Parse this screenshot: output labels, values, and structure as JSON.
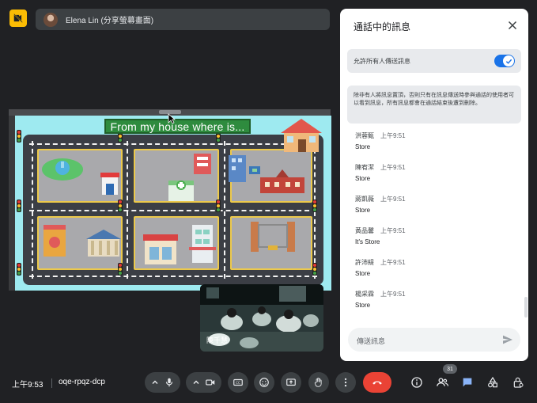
{
  "presenter": {
    "name": "Elena Lin (分享螢幕畫面)"
  },
  "shared_screen": {
    "slide_title": "From my house where is..."
  },
  "self_view": {
    "name": "陳千慧"
  },
  "chat_panel": {
    "title": "通話中的訊息",
    "toggle_label": "允許所有人傳送訊息",
    "notice": "除非有人將訊息置頂，否則只有在訊息傳送時參與通話的使用者可以看到訊息，所有訊息都會在通話結束後遭到刪除。",
    "messages": [
      {
        "sender": "洪蓉甄",
        "time": "上午9:51",
        "text": "Store"
      },
      {
        "sender": "陳宥潔",
        "time": "上午9:51",
        "text": "Store"
      },
      {
        "sender": "蔣凱薇",
        "time": "上午9:51",
        "text": "Store"
      },
      {
        "sender": "黃品馨",
        "time": "上午9:51",
        "text": "It's Store"
      },
      {
        "sender": "許沛緹",
        "time": "上午9:51",
        "text": "Store"
      },
      {
        "sender": "楊采霖",
        "time": "上午9:51",
        "text": "Store"
      }
    ],
    "send_placeholder": "傳送訊息"
  },
  "bottom_bar": {
    "clock": "上午9:53",
    "meeting_code": "oqe-rpqz-dcp",
    "participants_count": "31"
  },
  "colors": {
    "background": "#202124",
    "accent": "#1a73e8",
    "end_call": "#ea4335",
    "warning": "#fbbc04"
  }
}
